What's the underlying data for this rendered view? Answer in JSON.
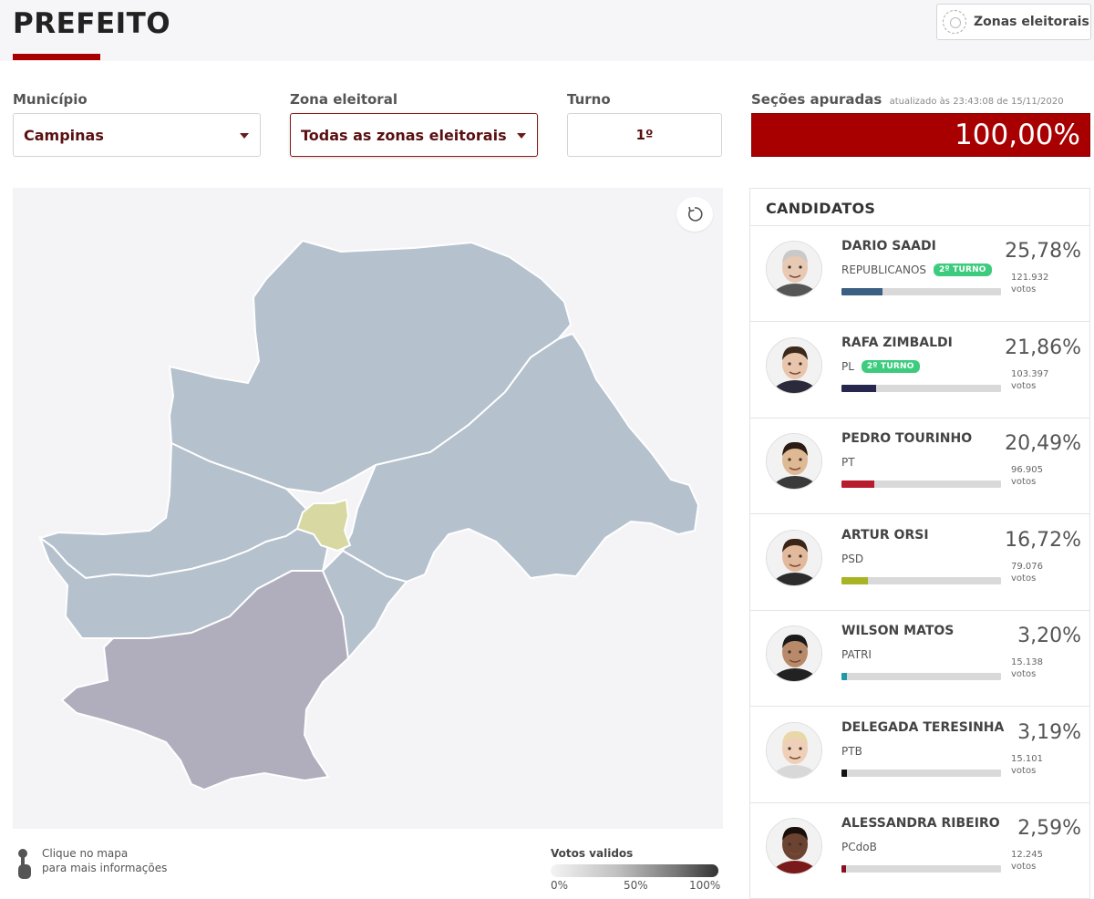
{
  "header": {
    "title": "PREFEITO",
    "zones_button": "Zonas eleitorais",
    "zones_icon": "radar-circle-icon"
  },
  "filters": {
    "municipio_label": "Município",
    "municipio_value": "Campinas",
    "zona_label": "Zona eleitoral",
    "zona_value": "Todas as zonas eleitorais",
    "turno_label": "Turno",
    "turno_value": "1º",
    "secoes_label": "Seções apuradas",
    "secoes_updated": "atualizado às 23:43:08 de 15/11/2020",
    "secoes_value": "100,00%",
    "secoes_progress": 1.0
  },
  "map": {
    "hint_line1": "Clique no mapa",
    "hint_line2": "para mais informações",
    "hint_icon": "tap-hand-icon",
    "reset_icon": "reset-rotate-icon",
    "legend_title": "Votos validos",
    "legend_ticks": [
      "0%",
      "50%",
      "100%"
    ],
    "colors": {
      "region": "#b5c1cd",
      "south": "#b0adbd",
      "center": "#d8d9a2",
      "border": "#ffffff"
    }
  },
  "candidates": {
    "title": "CANDIDATOS",
    "unit": "votos",
    "items": [
      {
        "name": "DARIO SAADI",
        "party": "REPUBLICANOS",
        "badge": "2º TURNO",
        "pct": "25,78%",
        "votes": "121.932",
        "share": 25.78,
        "color": "#3b5f80",
        "skin": "#e7c9b4",
        "hair": "#c9c9c9",
        "shirt": "#555555"
      },
      {
        "name": "RAFA ZIMBALDI",
        "party": "PL",
        "badge": "2º TURNO",
        "pct": "21,86%",
        "votes": "103.397",
        "share": 21.86,
        "color": "#27264f",
        "skin": "#e9c5ac",
        "hair": "#3b2a1c",
        "shirt": "#2a2a3a"
      },
      {
        "name": "PEDRO TOURINHO",
        "party": "PT",
        "badge": "",
        "pct": "20,49%",
        "votes": "96.905",
        "share": 20.49,
        "color": "#b81c2f",
        "skin": "#dfb894",
        "hair": "#2a1c12",
        "shirt": "#3a3a3a"
      },
      {
        "name": "ARTUR ORSI",
        "party": "PSD",
        "badge": "",
        "pct": "16,72%",
        "votes": "79.076",
        "share": 16.72,
        "color": "#a8b325",
        "skin": "#e3b99c",
        "hair": "#3a2618",
        "shirt": "#2c2c2c"
      },
      {
        "name": "WILSON MATOS",
        "party": "PATRI",
        "badge": "",
        "pct": "3,20%",
        "votes": "15.138",
        "share": 3.2,
        "color": "#1f9aa6",
        "skin": "#b98a6a",
        "hair": "#1a1a1a",
        "shirt": "#222222"
      },
      {
        "name": "DELEGADA TERESINHA",
        "party": "PTB",
        "badge": "",
        "pct": "3,19%",
        "votes": "15.101",
        "share": 3.19,
        "color": "#111111",
        "skin": "#f0cfb8",
        "hair": "#e8d8a8",
        "shirt": "#d8d8d8"
      },
      {
        "name": "ALESSANDRA RIBEIRO",
        "party": "PCdoB",
        "badge": "",
        "pct": "2,59%",
        "votes": "12.245",
        "share": 2.59,
        "color": "#8a1020",
        "skin": "#6b4330",
        "hair": "#1a0f0a",
        "shirt": "#7a1a1a"
      }
    ]
  }
}
